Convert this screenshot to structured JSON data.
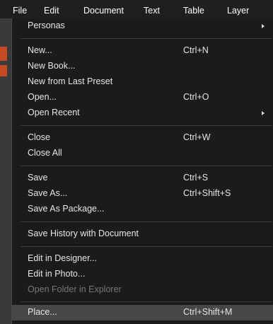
{
  "menubar": {
    "items": [
      {
        "label": "File"
      },
      {
        "label": "Edit"
      },
      {
        "label": "Document"
      },
      {
        "label": "Text"
      },
      {
        "label": "Table"
      },
      {
        "label": "Layer"
      }
    ]
  },
  "file_menu": {
    "personas": {
      "label": "Personas"
    },
    "new": {
      "label": "New...",
      "shortcut": "Ctrl+N"
    },
    "new_book": {
      "label": "New Book..."
    },
    "new_from_last_preset": {
      "label": "New from Last Preset"
    },
    "open": {
      "label": "Open...",
      "shortcut": "Ctrl+O"
    },
    "open_recent": {
      "label": "Open Recent"
    },
    "close": {
      "label": "Close",
      "shortcut": "Ctrl+W"
    },
    "close_all": {
      "label": "Close All"
    },
    "save": {
      "label": "Save",
      "shortcut": "Ctrl+S"
    },
    "save_as": {
      "label": "Save As...",
      "shortcut": "Ctrl+Shift+S"
    },
    "save_as_package": {
      "label": "Save As Package..."
    },
    "save_history": {
      "label": "Save History with Document"
    },
    "edit_in_designer": {
      "label": "Edit in Designer..."
    },
    "edit_in_photo": {
      "label": "Edit in Photo..."
    },
    "open_folder": {
      "label": "Open Folder in Explorer",
      "disabled": true
    },
    "place": {
      "label": "Place...",
      "shortcut": "Ctrl+Shift+M",
      "highlighted": true
    }
  },
  "colors": {
    "menu_background": "#1b1b1b",
    "menubar_background": "#1f1f1f",
    "highlight": "#474747",
    "text": "#e6e6e6",
    "disabled_text": "#777777",
    "accent_orange": "#c64a1f"
  }
}
